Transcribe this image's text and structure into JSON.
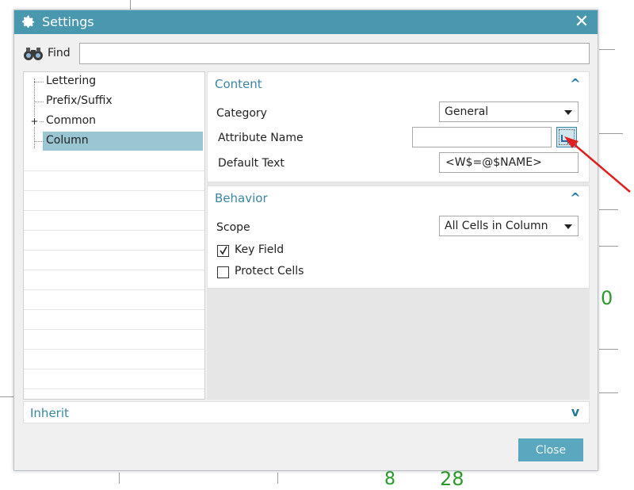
{
  "window": {
    "title": "Settings",
    "close_glyph": "✕"
  },
  "find": {
    "label": "Find",
    "value": "",
    "icon": "binoculars-icon"
  },
  "tree": {
    "items": [
      {
        "label": "Lettering",
        "selected": false
      },
      {
        "label": "Prefix/Suffix",
        "selected": false
      },
      {
        "label": "Common",
        "selected": false,
        "expander": "+"
      },
      {
        "label": "Column",
        "selected": true
      }
    ]
  },
  "content_panel": {
    "title": "Content",
    "collapse_glyph": "^",
    "category": {
      "label": "Category",
      "value": "General"
    },
    "attribute_name": {
      "label": "Attribute Name",
      "value": ""
    },
    "default_text": {
      "label": "Default Text",
      "value": "<W$=@$NAME>"
    }
  },
  "behavior_panel": {
    "title": "Behavior",
    "collapse_glyph": "^",
    "scope": {
      "label": "Scope",
      "value": "All Cells in Column"
    },
    "key_field": {
      "label": "Key Field",
      "checked": true
    },
    "protect_cells": {
      "label": "Protect Cells",
      "checked": false
    }
  },
  "inherit_panel": {
    "title": "Inherit",
    "expand_glyph": "v"
  },
  "footer": {
    "close_label": "Close"
  },
  "background": {
    "glyph_0": "0",
    "glyph_8": "8",
    "glyph_28": "28"
  },
  "colors": {
    "titlebar": "#4a98b0",
    "accent_text": "#3a86a3",
    "selection": "#9ac6d4",
    "close_button": "#5aa8c0",
    "annotation_arrow": "#e02020"
  }
}
